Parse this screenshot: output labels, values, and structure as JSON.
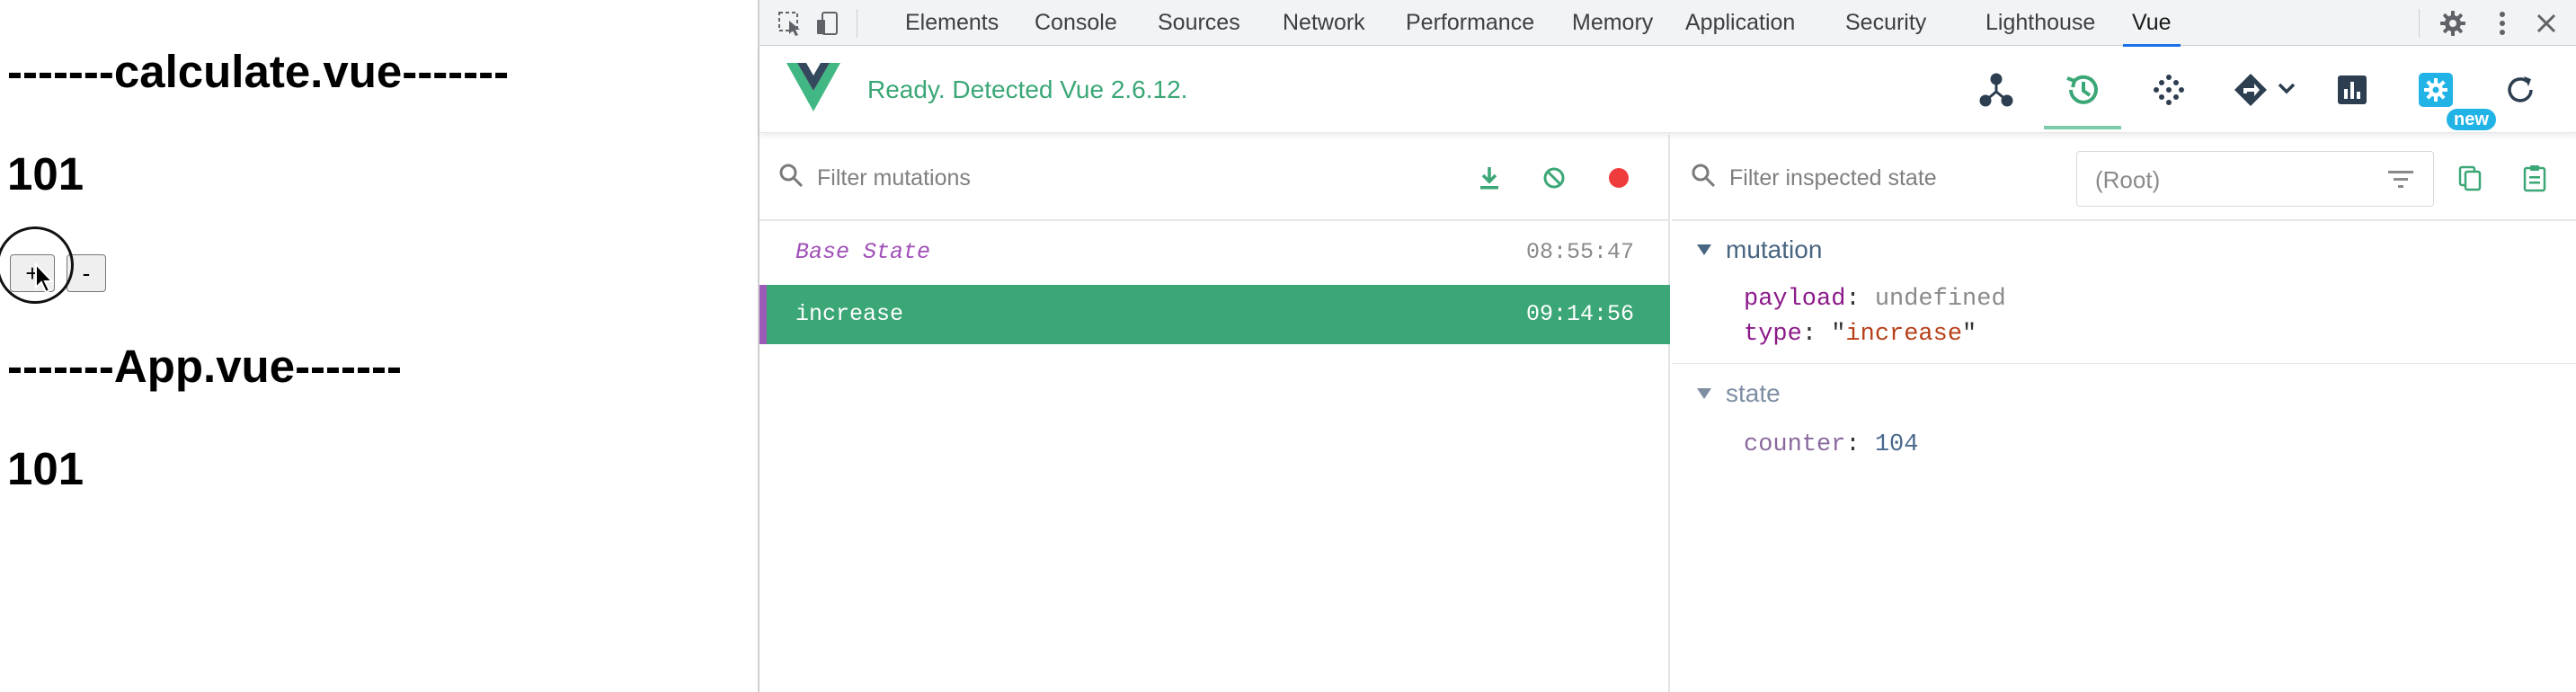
{
  "page": {
    "calculate_title": "-------calculate.vue-------",
    "calculate_count": "101",
    "plus_label": "+",
    "minus_label": "-",
    "app_title": "-------App.vue-------",
    "app_count": "101"
  },
  "devtools": {
    "tabs": [
      {
        "label": "Elements"
      },
      {
        "label": "Console"
      },
      {
        "label": "Sources"
      },
      {
        "label": "Network"
      },
      {
        "label": "Performance"
      },
      {
        "label": "Memory"
      },
      {
        "label": "Application"
      },
      {
        "label": "Security"
      },
      {
        "label": "Lighthouse"
      },
      {
        "label": "Vue",
        "active": true
      }
    ],
    "icons": [
      "inspect-element-icon",
      "device-toolbar-icon",
      "settings-gear-icon",
      "more-vert-icon"
    ]
  },
  "vue": {
    "status": "Ready. Detected Vue 2.6.12.",
    "new_badge": "new",
    "header_icons": [
      "components-icon",
      "history-icon",
      "events-icon",
      "routing-icon",
      "performance-icon",
      "settings-icon",
      "refresh-icon"
    ],
    "accent_color": "#42b883",
    "active_row_color": "#3ba776",
    "mutations": {
      "filter_placeholder": "Filter mutations",
      "rows": [
        {
          "name": "Base State",
          "time": "08:55:47"
        },
        {
          "name": "increase",
          "time": "09:14:56",
          "selected": true
        }
      ]
    },
    "state": {
      "filter_placeholder": "Filter inspected state",
      "root_select": "(Root)",
      "mutation_section": "mutation",
      "payload_key": "payload",
      "payload_value": "undefined",
      "type_key": "type",
      "type_value": "increase",
      "state_section": "state",
      "counter_key": "counter",
      "counter_value": "104"
    }
  }
}
